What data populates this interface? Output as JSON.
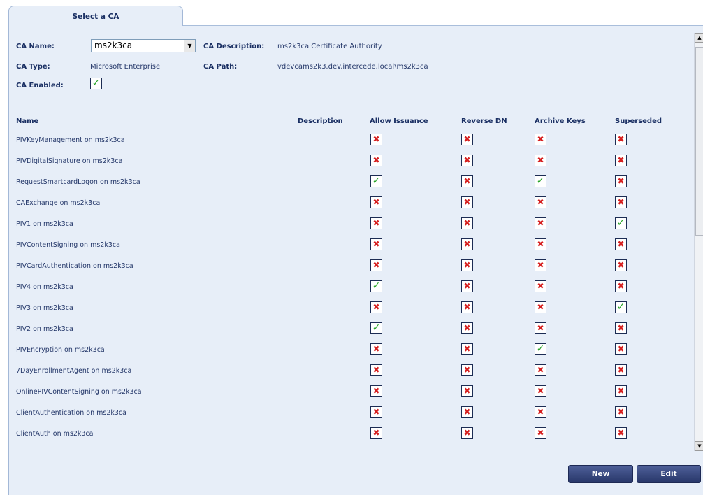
{
  "tab": {
    "label": "Select a CA"
  },
  "ca": {
    "name_label": "CA Name:",
    "name_value": "ms2k3ca",
    "description_label": "CA Description:",
    "description_value": "ms2k3ca Certificate Authority",
    "type_label": "CA Type:",
    "type_value": "Microsoft Enterprise",
    "path_label": "CA Path:",
    "path_value": "vdevcams2k3.dev.intercede.local\\ms2k3ca",
    "enabled_label": "CA Enabled:",
    "enabled": true
  },
  "table": {
    "headers": {
      "name": "Name",
      "description": "Description",
      "allow_issuance": "Allow Issuance",
      "reverse_dn": "Reverse DN",
      "archive_keys": "Archive Keys",
      "superseded": "Superseded"
    },
    "rows": [
      {
        "name": "PIVKeyManagement on ms2k3ca",
        "allow": false,
        "reverse": false,
        "archive": false,
        "superseded": false
      },
      {
        "name": "PIVDigitalSignature on ms2k3ca",
        "allow": false,
        "reverse": false,
        "archive": false,
        "superseded": false
      },
      {
        "name": "RequestSmartcardLogon on ms2k3ca",
        "allow": true,
        "reverse": false,
        "archive": true,
        "superseded": false
      },
      {
        "name": "CAExchange on ms2k3ca",
        "allow": false,
        "reverse": false,
        "archive": false,
        "superseded": false
      },
      {
        "name": "PIV1 on ms2k3ca",
        "allow": false,
        "reverse": false,
        "archive": false,
        "superseded": true
      },
      {
        "name": "PIVContentSigning on ms2k3ca",
        "allow": false,
        "reverse": false,
        "archive": false,
        "superseded": false
      },
      {
        "name": "PIVCardAuthentication on ms2k3ca",
        "allow": false,
        "reverse": false,
        "archive": false,
        "superseded": false
      },
      {
        "name": "PIV4 on ms2k3ca",
        "allow": true,
        "reverse": false,
        "archive": false,
        "superseded": false
      },
      {
        "name": "PIV3 on ms2k3ca",
        "allow": false,
        "reverse": false,
        "archive": false,
        "superseded": true
      },
      {
        "name": "PIV2 on ms2k3ca",
        "allow": true,
        "reverse": false,
        "archive": false,
        "superseded": false
      },
      {
        "name": "PIVEncryption on ms2k3ca",
        "allow": false,
        "reverse": false,
        "archive": true,
        "superseded": false
      },
      {
        "name": "7DayEnrollmentAgent on ms2k3ca",
        "allow": false,
        "reverse": false,
        "archive": false,
        "superseded": false
      },
      {
        "name": "OnlinePIVContentSigning on ms2k3ca",
        "allow": false,
        "reverse": false,
        "archive": false,
        "superseded": false
      },
      {
        "name": "ClientAuthentication on ms2k3ca",
        "allow": false,
        "reverse": false,
        "archive": false,
        "superseded": false
      },
      {
        "name": "ClientAuth on ms2k3ca",
        "allow": false,
        "reverse": false,
        "archive": false,
        "superseded": false
      }
    ]
  },
  "buttons": {
    "new": "New",
    "edit": "Edit"
  },
  "icons": {
    "check": "check-icon",
    "cross": "cross-icon",
    "dropdown": "dropdown-arrow-icon"
  },
  "colors": {
    "check": "#28a428",
    "cross": "#d62020",
    "panel": "#e7eef8",
    "button": "#2f3d73"
  }
}
